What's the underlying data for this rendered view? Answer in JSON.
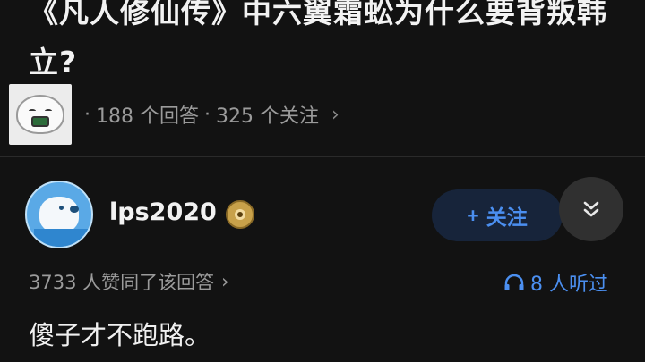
{
  "question": {
    "title": "《凡人修仙传》中六翼霜蚣为什么要背叛韩立?",
    "answers_count": "188 个回答",
    "separator": "·",
    "follows_count": "325 个关注",
    "more_icon": "chevron-right-icon"
  },
  "answer": {
    "author_name": "lps2020",
    "badge_icon": "medal-badge-icon",
    "follow_label": "关注",
    "follow_plus": "+",
    "expand_icon": "double-chevron-down-icon",
    "upvotes_text": "3733 人赞同了该回答",
    "upvotes_chevron": "›",
    "listen_count": "8 人听过",
    "listen_icon": "headphones-icon",
    "content": "傻子才不跑路。"
  },
  "colors": {
    "background": "#121212",
    "accent_blue": "#4b8ff0",
    "muted_text": "#9b9b9b"
  }
}
